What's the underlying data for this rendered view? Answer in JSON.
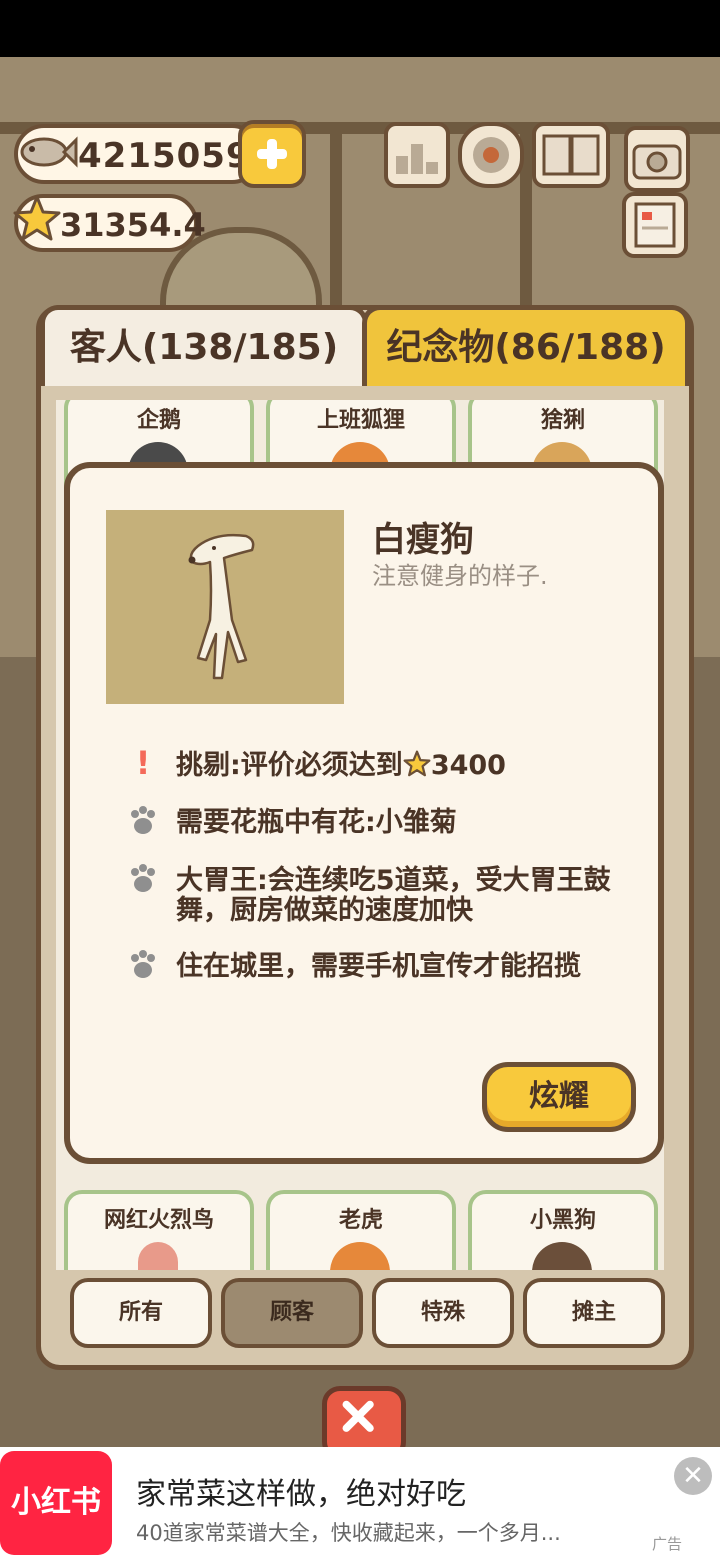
{
  "hud": {
    "fish_count": "4215059",
    "star_rating": "31354.4",
    "icons": [
      "fish-icon",
      "star-icon",
      "plus-icon",
      "ranking-icon",
      "settings-gear-icon",
      "book-icon",
      "camera-icon",
      "notebook-icon"
    ]
  },
  "tabs": [
    {
      "label": "客人(138/185)",
      "active": true
    },
    {
      "label": "纪念物(86/188)",
      "active": false
    }
  ],
  "guest_cards_top": [
    "企鹅",
    "上班狐狸",
    "猞猁"
  ],
  "guest_cards_bottom": [
    "网红火烈鸟",
    "老虎",
    "小黑狗"
  ],
  "filters": [
    "所有",
    "顾客",
    "特殊",
    "摊主"
  ],
  "active_filter": "顾客",
  "detail": {
    "name": "白瘦狗",
    "description": "注意健身的样子.",
    "traits": [
      {
        "icon": "exclamation-icon",
        "text_prefix": "挑剔:评价必须达到",
        "text_value": "3400"
      },
      {
        "icon": "paw-icon",
        "text": "需要花瓶中有花:小雏菊"
      },
      {
        "icon": "paw-icon",
        "text": "大胃王:会连续吃5道菜，受大胃王鼓舞，厨房做菜的速度加快"
      },
      {
        "icon": "paw-icon",
        "text": "住在城里，需要手机宣传才能招揽"
      }
    ],
    "show_button": "炫耀"
  },
  "ad": {
    "logo_text": "小红书",
    "title": "家常菜这样做，绝对好吃",
    "subtitle": "40道家常菜谱大全，快收藏起来，一个多月...",
    "mark": "广告"
  },
  "colors": {
    "accent_yellow": "#f8c93c",
    "panel_border": "#6b4f36",
    "text_brown": "#4a3426",
    "ad_red": "#ff2442"
  }
}
